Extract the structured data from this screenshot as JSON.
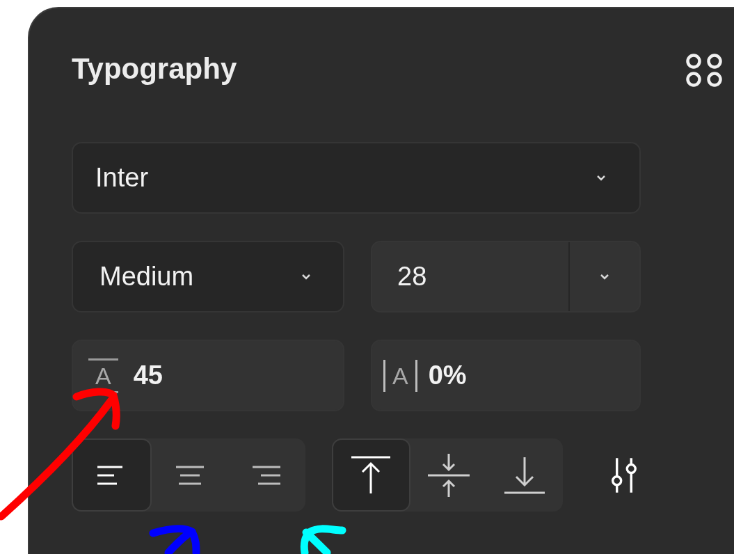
{
  "panel": {
    "title": "Typography"
  },
  "font_family": {
    "value": "Inter"
  },
  "font_weight": {
    "value": "Medium"
  },
  "font_size": {
    "value": "28"
  },
  "line_height": {
    "glyph": "A",
    "value": "45"
  },
  "letter_spacing": {
    "glyph": "A",
    "value": "0%"
  },
  "text_align": [
    {
      "kind": "left",
      "selected": true
    },
    {
      "kind": "center",
      "selected": false
    },
    {
      "kind": "right",
      "selected": false
    }
  ],
  "vertical_align": [
    {
      "kind": "top",
      "selected": true
    },
    {
      "kind": "middle",
      "selected": false
    },
    {
      "kind": "bottom",
      "selected": false
    }
  ],
  "annotations": [
    {
      "color": "#ff0000"
    },
    {
      "color": "#0000ff"
    },
    {
      "color": "#00ffff"
    }
  ]
}
